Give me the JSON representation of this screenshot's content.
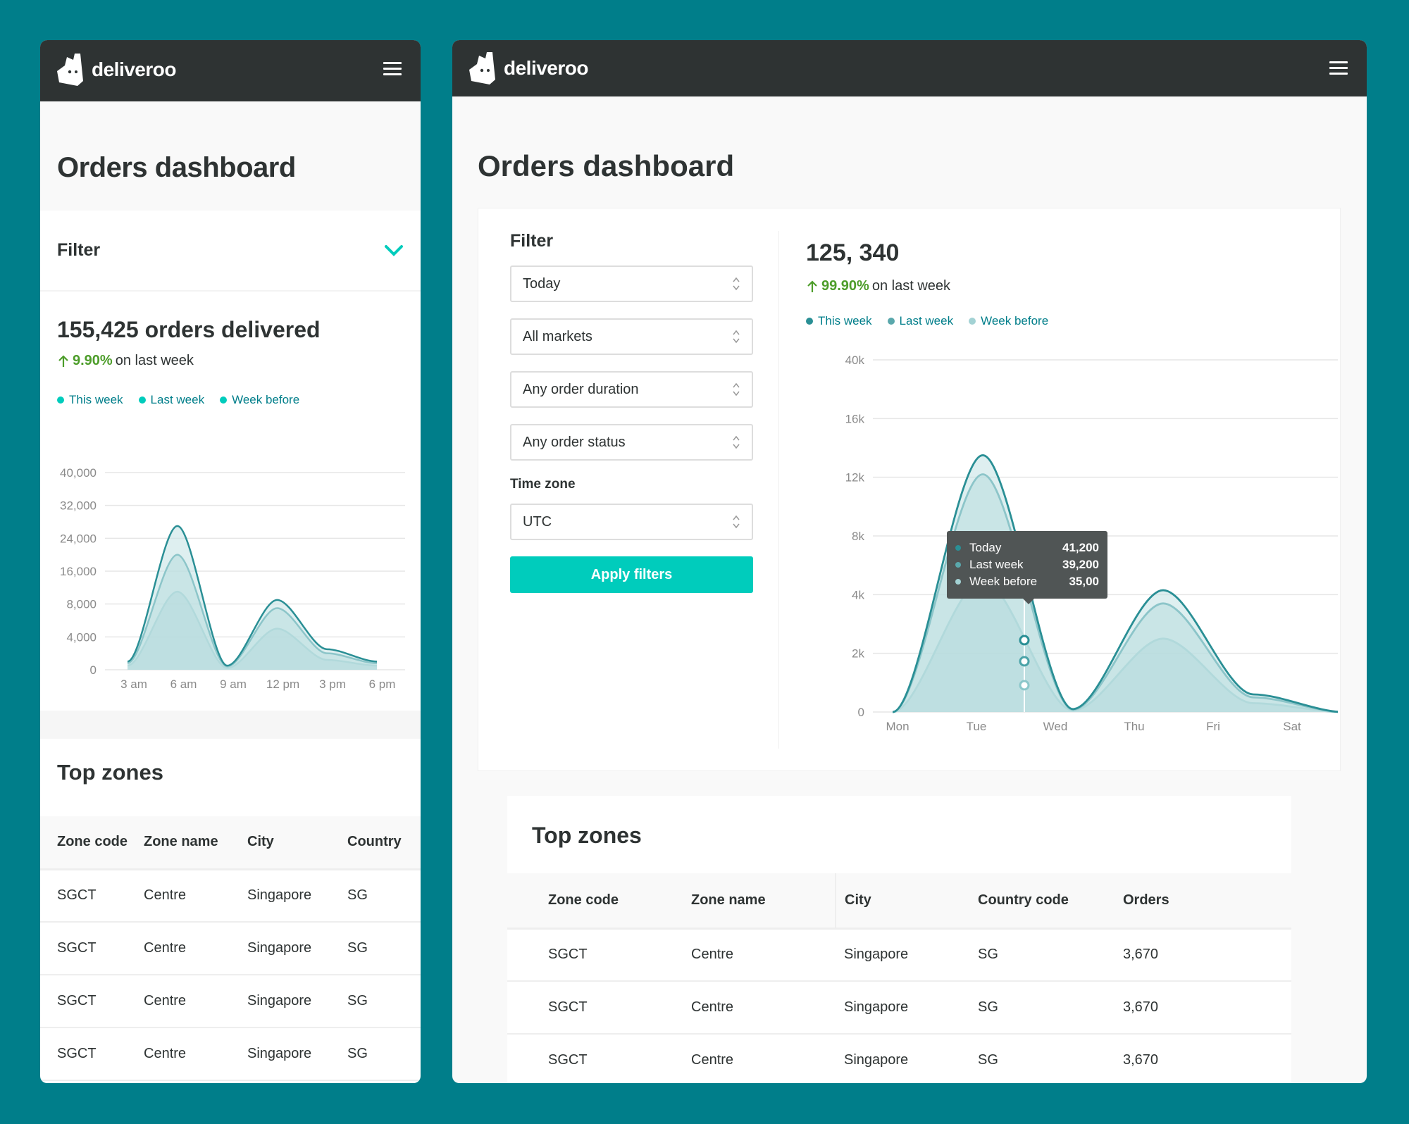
{
  "brand": {
    "name": "deliveroo"
  },
  "mobile": {
    "title": "Orders dashboard",
    "filter_label": "Filter",
    "stat": "155,425 orders delivered",
    "delta_pct": "9.90%",
    "delta_text": "on last week",
    "legend": [
      "This week",
      "Last week",
      "Week before"
    ],
    "top_zones_title": "Top zones",
    "table": {
      "headers": [
        "Zone code",
        "Zone name",
        "City",
        "Country"
      ],
      "rows": [
        [
          "SGCT",
          "Centre",
          "Singapore",
          "SG"
        ],
        [
          "SGCT",
          "Centre",
          "Singapore",
          "SG"
        ],
        [
          "SGCT",
          "Centre",
          "Singapore",
          "SG"
        ],
        [
          "SGCT",
          "Centre",
          "Singapore",
          "SG"
        ]
      ]
    }
  },
  "desktop": {
    "title": "Orders dashboard",
    "filter_label": "Filter",
    "selects": [
      "Today",
      "All markets",
      "Any order duration",
      "Any order status"
    ],
    "timezone_label": "Time zone",
    "timezone_value": "UTC",
    "apply_label": "Apply filters",
    "stat": "125, 340",
    "delta_pct": "99.90%",
    "delta_text": "on last week",
    "legend": [
      "This week",
      "Last week",
      "Week before"
    ],
    "tooltip": [
      {
        "name": "Today",
        "value": "41,200"
      },
      {
        "name": "Last week",
        "value": "39,200"
      },
      {
        "name": "Week before",
        "value": "35,00"
      }
    ],
    "top_zones_title": "Top zones",
    "table": {
      "headers": [
        "Zone code",
        "Zone name",
        "City",
        "Country code",
        "Orders"
      ],
      "rows": [
        [
          "SGCT",
          "Centre",
          "Singapore",
          "SG",
          "3,670"
        ],
        [
          "SGCT",
          "Centre",
          "Singapore",
          "SG",
          "3,670"
        ],
        [
          "SGCT",
          "Centre",
          "Singapore",
          "SG",
          "3,670"
        ]
      ]
    }
  },
  "colors": {
    "teal": "#007e8a",
    "accent": "#00ccbc",
    "dark": "#2e3333",
    "green": "#4d9d2a",
    "series": [
      "#2a8f95",
      "#5aa8ac",
      "#a3d2d4"
    ]
  },
  "chart_data": [
    {
      "type": "area",
      "x": [
        "3 am",
        "6 am",
        "9 am",
        "12 pm",
        "3 pm",
        "6 pm"
      ],
      "y_ticks": [
        "0",
        "4,000",
        "8,000",
        "16,000",
        "24,000",
        "32,000",
        "40,000"
      ],
      "ylim": [
        0,
        40000
      ],
      "series": [
        {
          "name": "This week",
          "values": [
            1000,
            27000,
            500,
            9000,
            2500,
            1000
          ]
        },
        {
          "name": "Last week",
          "values": [
            800,
            20000,
            400,
            7500,
            2000,
            800
          ]
        },
        {
          "name": "Week before",
          "values": [
            500,
            11000,
            200,
            5000,
            1200,
            500
          ]
        }
      ]
    },
    {
      "type": "area",
      "x": [
        "Mon",
        "Tue",
        "Wed",
        "Thu",
        "Fri",
        "Sat"
      ],
      "y_ticks": [
        "0",
        "2k",
        "4k",
        "8k",
        "12k",
        "16k",
        "40k"
      ],
      "series": [
        {
          "name": "This week",
          "values": [
            0,
            13500,
            100,
            4300,
            600,
            0
          ]
        },
        {
          "name": "Last week",
          "values": [
            0,
            12200,
            80,
            3700,
            500,
            0
          ]
        },
        {
          "name": "Week before",
          "values": [
            0,
            5000,
            50,
            2500,
            300,
            0
          ]
        }
      ]
    }
  ]
}
